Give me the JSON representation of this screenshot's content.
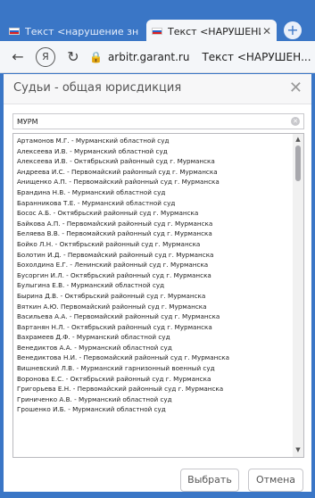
{
  "browser": {
    "tabs": [
      {
        "title": "Текст <нарушение знака"
      },
      {
        "title": "Текст <НАРУШЕНИЕ З"
      }
    ],
    "address": {
      "yandex_icon": "Я",
      "url": "arbitr.garant.ru",
      "page_title": "Текст <НАРУШЕН..."
    }
  },
  "dialog": {
    "title": "Судьи - общая юрисдикция",
    "search": {
      "value": "МУРМ"
    },
    "items": [
      "Артамонов М.Г. - Мурманский областной суд",
      "Алексеева И.В. - Мурманский областной суд",
      "Алексеева И.В. - Октябрьский районный суд г. Мурманска",
      "Андреева И.С. - Первомайский районный суд г. Мурманска",
      "Анищенко А.П. - Первомайский районный суд г. Мурманска",
      "Брандина Н.В. - Мурманский областной суд",
      "Баранникова Т.Е. - Мурманский областной суд",
      "Босос А.Б. - Октябрьский районный суд г. Мурманска",
      "Байкова А.П. - Первомайский районный суд г. Мурманска",
      "Беляева В.В. - Первомайский районный суд г. Мурманска",
      "Бойко Л.Н. - Октябрьский районный суд г. Мурманска",
      "Болотин И.Д. - Первомайский районный суд г. Мурманска",
      "Бохолдина Е.Г. - Ленинский районный суд г. Мурманска",
      "Бусоргин И.Л. - Октябрьский районный суд г. Мурманска",
      "Булыгина Е.В. - Мурманский областной суд",
      "Бырина Д.В. - Октябрьский районный суд г. Мурманска",
      "Вяткин А.Ю. Первомайский районный суд г. Мурманска",
      "Васильева А.А. - Первомайский районный суд г. Мурманска",
      "Вартанян Н.Л. - Октябрьский районный суд г. Мурманска",
      "Вахрамеев Д.Ф. - Мурманский областной суд",
      "Венедиктов А.А. - Мурманский областной суд",
      "Венедиктова Н.И. - Первомайский районный суд г. Мурманска",
      "Вишневский Л.В. - Мурманский гарнизонный военный суд",
      "Воронова Е.С. - Октябрьский районный суд г. Мурманска",
      "Григорьева Е.Н. - Первомайский районный суд г. Мурманска",
      "Гриниченко А.В. - Мурманский областной суд",
      "Грошенко И.Б. - Мурманский областной суд"
    ],
    "buttons": {
      "select": "Выбрать",
      "cancel": "Отмена"
    }
  }
}
